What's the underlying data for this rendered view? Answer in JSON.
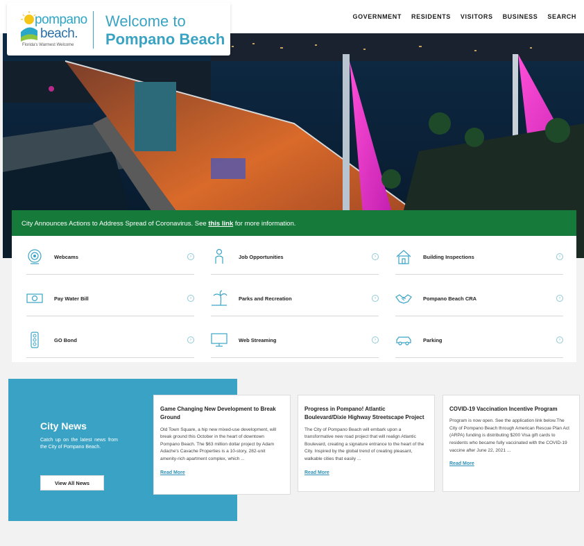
{
  "header": {
    "logo_word1": "pompano",
    "logo_word2": "beach.",
    "logo_tagline": "Florida's Warmest Welcome",
    "title_line1": "Welcome to",
    "title_line2": "Pompano Beach",
    "nav": [
      "GOVERNMENT",
      "RESIDENTS",
      "VISITORS",
      "BUSINESS",
      "SEARCH"
    ]
  },
  "alert": {
    "prefix": "City Announces Actions to Address Spread of Coronavirus. See",
    "link": "this link",
    "suffix": "for more information."
  },
  "quick_links": [
    {
      "label": "Webcams",
      "icon": "webcam-icon"
    },
    {
      "label": "Job Opportunities",
      "icon": "person-icon"
    },
    {
      "label": "Building Inspections",
      "icon": "house-icon"
    },
    {
      "label": "Pay Water Bill",
      "icon": "money-icon"
    },
    {
      "label": "Parks and Recreation",
      "icon": "palm-tree-icon"
    },
    {
      "label": "Pompano Beach CRA",
      "icon": "handshake-icon"
    },
    {
      "label": "GO Bond",
      "icon": "traffic-light-icon"
    },
    {
      "label": "Web Streaming",
      "icon": "monitor-icon"
    },
    {
      "label": "Parking",
      "icon": "car-icon"
    }
  ],
  "news": {
    "title": "City News",
    "description": "Catch up on the latest news from the City of Pompano Beach.",
    "button": "View All News",
    "read_more": "Read More",
    "articles": [
      {
        "title": "Game Changing New Development to Break Ground",
        "body": "Old Town Square, a hip new mixed-use development, will break ground this October in the heart of downtown Pompano Beach. The $63 million dollar project by Adam Adache's Cavache Properties is a 10-story, 282-unit amenity-rich apartment complex, which ..."
      },
      {
        "title": "Progress in Pompano! Atlantic Boulevard/Dixie Highway Streetscape Project",
        "body": "The City of Pompano Beach will embark upon a transformative new road project that will realign Atlantic Boulevard, creating a signature entrance to the heart of the City. Inspired by the global trend of creating pleasant, walkable cities that easily ..."
      },
      {
        "title": "COVID-19 Vaccination Incentive Program",
        "body": "Program is now open. See the application link below.The City of Pompano Beach through American Rescue Plan Act (ARPA) funding is distributing $200 Visa gift cards to residents who became fully vaccinated with the COVID-19 vaccine after June 22, 2021 ..."
      }
    ]
  },
  "colors": {
    "brand_teal": "#3aa3c5",
    "alert_green": "#157a3a",
    "link_blue": "#2d8fb5"
  }
}
